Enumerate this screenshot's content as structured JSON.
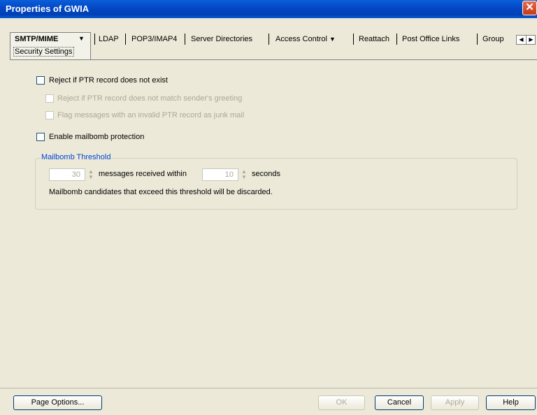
{
  "window": {
    "title": "Properties of GWIA"
  },
  "tabs": {
    "active_main": "SMTP/MIME",
    "active_sub": "Security Settings",
    "items": [
      "LDAP",
      "POP3/IMAP4",
      "Server Directories",
      "Access Control",
      "Reattach",
      "Post Office Links",
      "Group"
    ]
  },
  "options": {
    "reject_ptr": "Reject if PTR record does not exist",
    "reject_ptr_mismatch": "Reject if PTR record does not match sender's greeting",
    "flag_invalid_ptr": "Flag messages with an invalid PTR record as junk mail",
    "enable_mailbomb": "Enable mailbomb protection"
  },
  "mailbomb": {
    "group_title": "Mailbomb Threshold",
    "messages_value": "30",
    "messages_label": "messages received within",
    "seconds_value": "10",
    "seconds_label": "seconds",
    "note": "Mailbomb candidates that exceed this threshold will be discarded."
  },
  "buttons": {
    "page_options": "Page Options...",
    "ok": "OK",
    "cancel": "Cancel",
    "apply": "Apply",
    "help": "Help"
  },
  "colors": {
    "title_bar": "#0349c8",
    "group_title": "#0046d5",
    "background": "#ece9d8"
  }
}
